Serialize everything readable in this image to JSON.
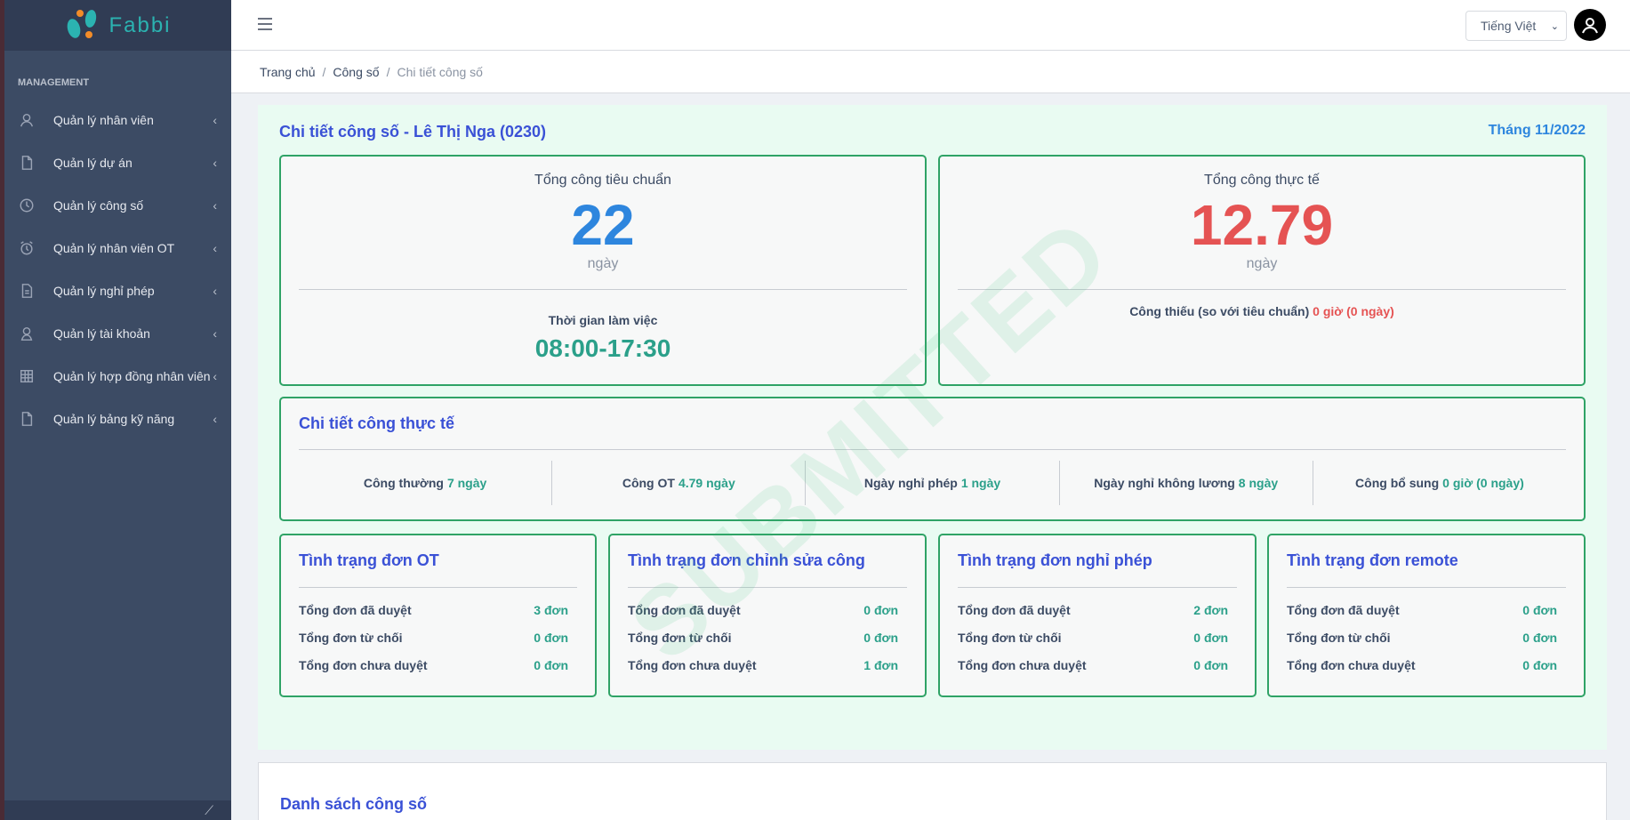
{
  "brand": {
    "name": "Fabbi"
  },
  "sidebar": {
    "section_title": "MANAGEMENT",
    "items": [
      {
        "label": "Quản lý nhân viên",
        "icon": "user-icon"
      },
      {
        "label": "Quản lý dự án",
        "icon": "file-icon"
      },
      {
        "label": "Quản lý công số",
        "icon": "clock-icon"
      },
      {
        "label": "Quản lý nhân viên OT",
        "icon": "alarm-icon"
      },
      {
        "label": "Quản lý nghỉ phép",
        "icon": "document-icon"
      },
      {
        "label": "Quản lý tài khoản",
        "icon": "user-icon"
      },
      {
        "label": "Quản lý hợp đồng nhân viên",
        "icon": "grid-icon"
      },
      {
        "label": "Quản lý bảng kỹ năng",
        "icon": "file-icon"
      }
    ]
  },
  "header": {
    "language": "Tiếng Việt"
  },
  "breadcrumb": {
    "home": "Trang chủ",
    "parent": "Công số",
    "current": "Chi tiết công số"
  },
  "detail": {
    "title": "Chi tiết công số - Lê Thị Nga (0230)",
    "month": "Tháng 11/2022",
    "watermark": "SUBMITTED",
    "standard": {
      "label": "Tổng công tiêu chuẩn",
      "value": "22",
      "unit": "ngày",
      "worktime_label": "Thời gian làm việc",
      "worktime": "08:00-17:30"
    },
    "actual": {
      "label": "Tổng công thực tế",
      "value": "12.79",
      "unit": "ngày",
      "missing_label": "Công thiếu (so với tiêu chuẩn)",
      "missing_value": "0 giờ (0 ngày)"
    },
    "breakdown": {
      "title": "Chi tiết công thực tế",
      "items": [
        {
          "label": "Công thường",
          "value": "7 ngày"
        },
        {
          "label": "Công OT",
          "value": "4.79 ngày"
        },
        {
          "label": "Ngày nghỉ phép",
          "value": "1 ngày"
        },
        {
          "label": "Ngày nghỉ không lương",
          "value": "8 ngày"
        },
        {
          "label": "Công bổ sung",
          "value": "0 giờ (0 ngày)"
        }
      ]
    },
    "requests": [
      {
        "title": "Tình trạng đơn OT",
        "approved_label": "Tổng đơn đã duyệt",
        "approved": "3 đơn",
        "rejected_label": "Tổng đơn từ chối",
        "rejected": "0 đơn",
        "pending_label": "Tổng đơn chưa duyệt",
        "pending": "0 đơn"
      },
      {
        "title": "Tình trạng đơn chỉnh sửa công",
        "approved_label": "Tổng đơn đã duyệt",
        "approved": "0 đơn",
        "rejected_label": "Tổng đơn từ chối",
        "rejected": "0 đơn",
        "pending_label": "Tổng đơn chưa duyệt",
        "pending": "1 đơn"
      },
      {
        "title": "Tình trạng đơn nghỉ phép",
        "approved_label": "Tổng đơn đã duyệt",
        "approved": "2 đơn",
        "rejected_label": "Tổng đơn từ chối",
        "rejected": "0 đơn",
        "pending_label": "Tổng đơn chưa duyệt",
        "pending": "0 đơn"
      },
      {
        "title": "Tình trạng đơn remote",
        "approved_label": "Tổng đơn đã duyệt",
        "approved": "0 đơn",
        "rejected_label": "Tổng đơn từ chối",
        "rejected": "0 đơn",
        "pending_label": "Tổng đơn chưa duyệt",
        "pending": "0 đơn"
      }
    ]
  },
  "list": {
    "title": "Danh sách công số"
  },
  "colors": {
    "sidebar": "#3c4b64",
    "accent_green": "#2ba08a",
    "title_blue": "#3a51d6",
    "red": "#e55353",
    "panel_bg": "#e9fbf2"
  }
}
